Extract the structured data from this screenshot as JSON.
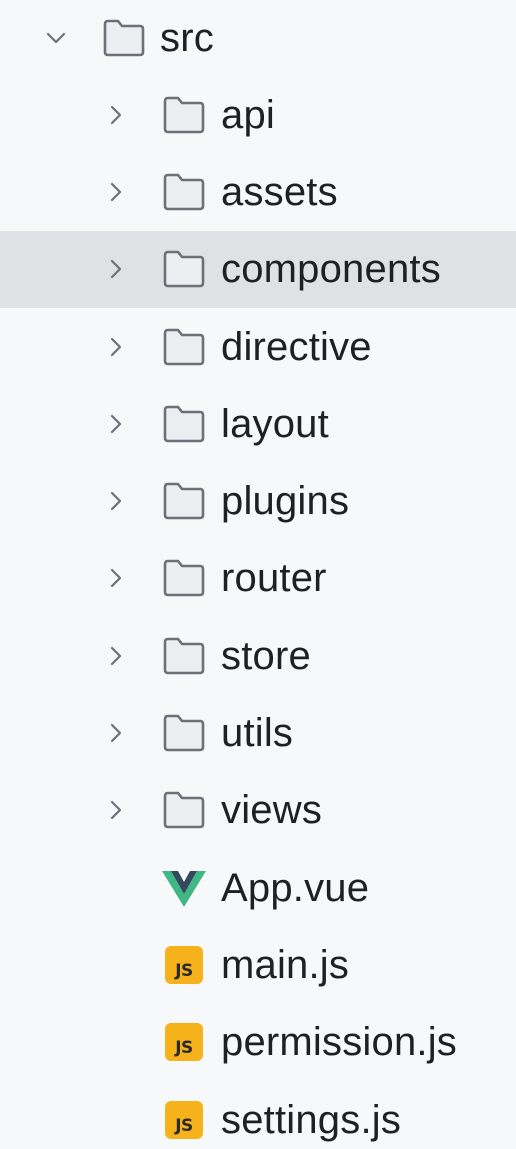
{
  "tree": {
    "root": {
      "label": "src",
      "expanded": true
    },
    "folders": [
      {
        "label": "api"
      },
      {
        "label": "assets"
      },
      {
        "label": "components",
        "selected": true
      },
      {
        "label": "directive"
      },
      {
        "label": "layout"
      },
      {
        "label": "plugins"
      },
      {
        "label": "router"
      },
      {
        "label": "store"
      },
      {
        "label": "utils"
      },
      {
        "label": "views"
      }
    ],
    "files": [
      {
        "label": "App.vue",
        "icon": "vue-icon"
      },
      {
        "label": "main.js",
        "icon": "js-file-icon",
        "badge": "JS"
      },
      {
        "label": "permission.js",
        "icon": "js-file-icon",
        "badge": "JS"
      },
      {
        "label": "settings.js",
        "icon": "js-file-icon",
        "badge": "JS"
      }
    ]
  },
  "colors": {
    "background": "#f7f8fa",
    "selected_row": "#dfe1e5",
    "folder_stroke": "#6e7078",
    "folder_fill": "#eceef2",
    "js_badge": "#f5b21b",
    "vue_green": "#41b883",
    "vue_dark": "#34495e"
  }
}
